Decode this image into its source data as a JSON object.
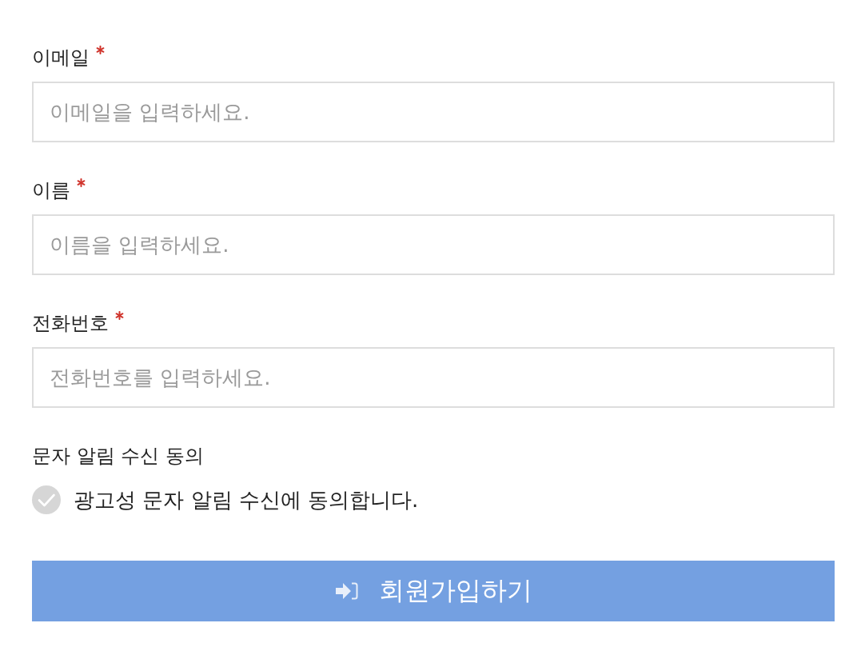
{
  "fields": [
    {
      "label": "이메일",
      "required": true,
      "placeholder": "이메일을 입력하세요."
    },
    {
      "label": "이름",
      "required": true,
      "placeholder": "이름을 입력하세요."
    },
    {
      "label": "전화번호",
      "required": true,
      "placeholder": "전화번호를 입력하세요."
    }
  ],
  "consent": {
    "title": "문자 알림 수신 동의",
    "checkbox": {
      "label": "광고성 문자 알림 수신에 동의합니다.",
      "checked": false
    }
  },
  "submit_button": {
    "label": "회원가입하기"
  }
}
